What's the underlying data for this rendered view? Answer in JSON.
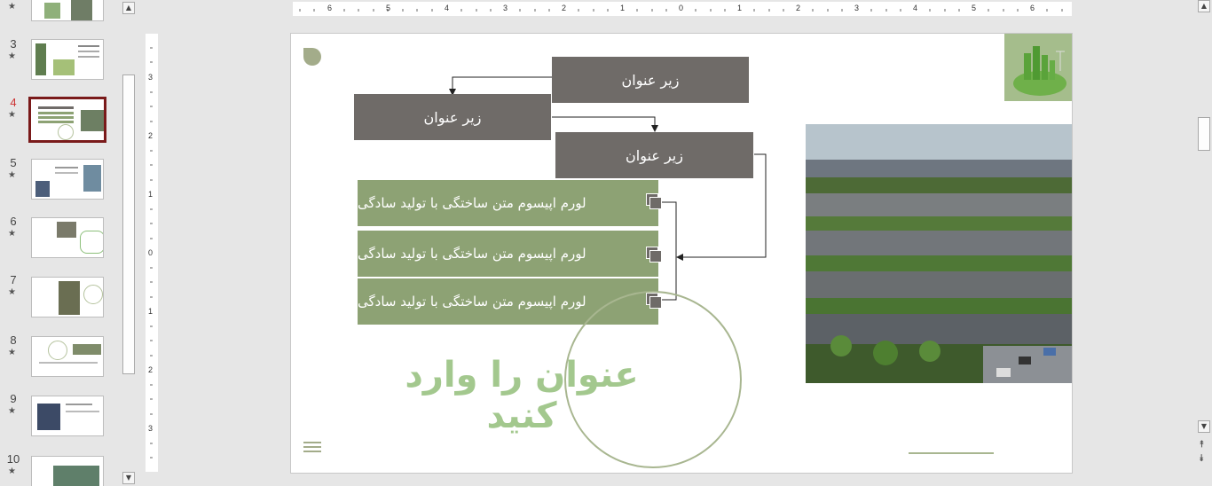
{
  "thumbnails": [
    {
      "num": "",
      "star": "★"
    },
    {
      "num": "3",
      "star": "★"
    },
    {
      "num": "4",
      "star": "★",
      "active": true
    },
    {
      "num": "5",
      "star": "★"
    },
    {
      "num": "6",
      "star": "★"
    },
    {
      "num": "7",
      "star": "★"
    },
    {
      "num": "8",
      "star": "★"
    },
    {
      "num": "9",
      "star": "★"
    },
    {
      "num": "10",
      "star": "★"
    }
  ],
  "ruler": {
    "h_labels": [
      "6",
      "5",
      "4",
      "3",
      "2",
      "1",
      "0",
      "1",
      "2",
      "3",
      "4",
      "5",
      "6"
    ],
    "v_labels": [
      "3",
      "2",
      "1",
      "0",
      "1",
      "2",
      "3"
    ]
  },
  "slide": {
    "boxes": {
      "top": "زیر عنوان",
      "left": "زیر عنوان",
      "right": "زیر عنوان"
    },
    "items": [
      "لورم اپیسوم متن ساختگی با تولید سادگی",
      "لورم اپیسوم متن ساختگی با تولید سادگی",
      "لورم اپیسوم متن ساختگی با تولید سادگی"
    ],
    "title": "عنوان را وارد کنید"
  },
  "colors": {
    "accent_green": "#8da274",
    "box_gray": "#6f6b68",
    "title_green": "#a3c88e",
    "active_border": "#7a1a1a"
  },
  "icons": {
    "scroll_up": "▲",
    "scroll_down": "▼",
    "prev_slide": "⯭",
    "next_slide": "⯯"
  }
}
